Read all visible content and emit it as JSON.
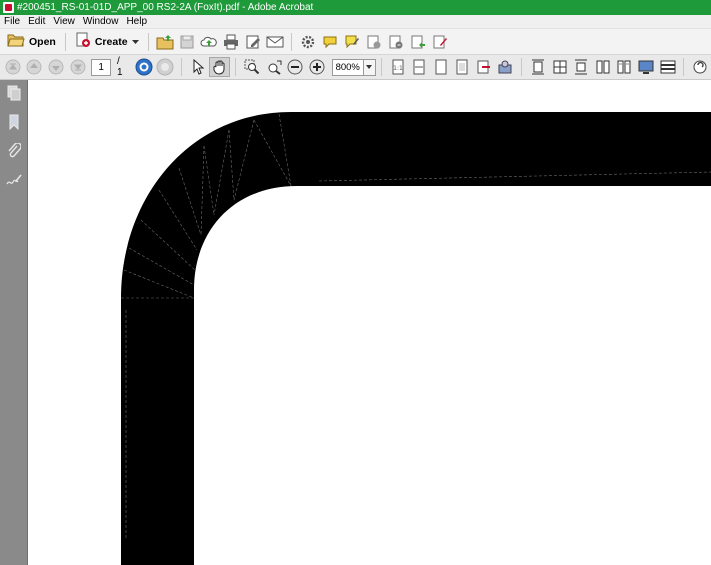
{
  "window": {
    "title": "#200451_RS-01-01D_APP_00 RS2-2A (FoxIt).pdf - Adobe Acrobat"
  },
  "menu": {
    "items": [
      "File",
      "Edit",
      "View",
      "Window",
      "Help"
    ]
  },
  "toolbar": {
    "open_label": "Open",
    "create_label": "Create"
  },
  "navigation": {
    "current_page": "1",
    "page_total": "/ 1",
    "zoom": "800%"
  },
  "icons": {
    "title": "acrobat-icon",
    "open": "folder-open-icon",
    "create": "create-pdf-icon",
    "tools": [
      "folder-up-icon",
      "save-icon",
      "cloud-upload-icon",
      "print-icon",
      "edit-icon",
      "email-icon",
      "gear-icon",
      "comment-icon",
      "highlight-icon",
      "stamp-icon",
      "attach-icon",
      "export-icon",
      "sign-icon"
    ],
    "nav": [
      "first-page-icon",
      "previous-page-icon",
      "next-page-icon",
      "last-page-icon"
    ],
    "side_panel": [
      "pages-icon",
      "bookmark-icon",
      "attachment-icon",
      "signature-icon"
    ]
  },
  "colors": {
    "titlebar": "#1e9a3a",
    "side_panel": "#8a8a8a",
    "drawing": "#000000"
  }
}
